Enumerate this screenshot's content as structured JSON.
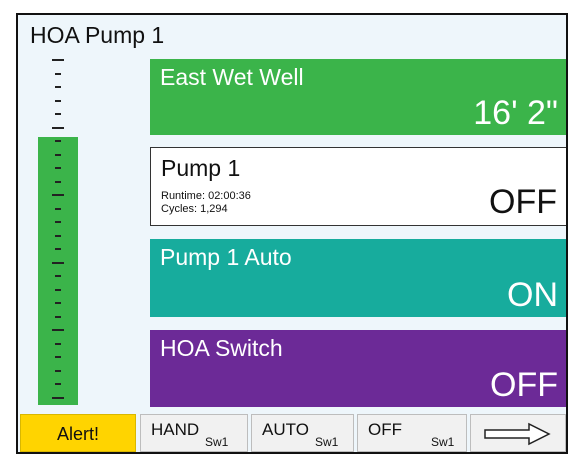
{
  "title": "HOA Pump 1",
  "gauge": {
    "level": 0.76,
    "ticks": 26,
    "fill_color": "#3bb44a"
  },
  "panels": {
    "wet_well": {
      "label": "East Wet Well",
      "value": "16' 2\"",
      "color": "#3bb44a"
    },
    "pump1": {
      "label": "Pump 1",
      "runtime": "Runtime: 02:00:36",
      "cycles": "Cycles: 1,294",
      "value": "OFF",
      "color": "#ffffff"
    },
    "pump1_auto": {
      "label": "Pump 1 Auto",
      "value": "ON",
      "color": "#17ac9d"
    },
    "hoa_switch": {
      "label": "HOA Switch",
      "value": "OFF",
      "color": "#6c2a97"
    }
  },
  "bottom_bar": {
    "alert": "Alert!",
    "hand": {
      "label": "HAND",
      "sub": "Sw1"
    },
    "auto": {
      "label": "AUTO",
      "sub": "Sw1"
    },
    "off": {
      "label": "OFF",
      "sub": "Sw1"
    },
    "next_icon": "right-arrow-icon"
  }
}
